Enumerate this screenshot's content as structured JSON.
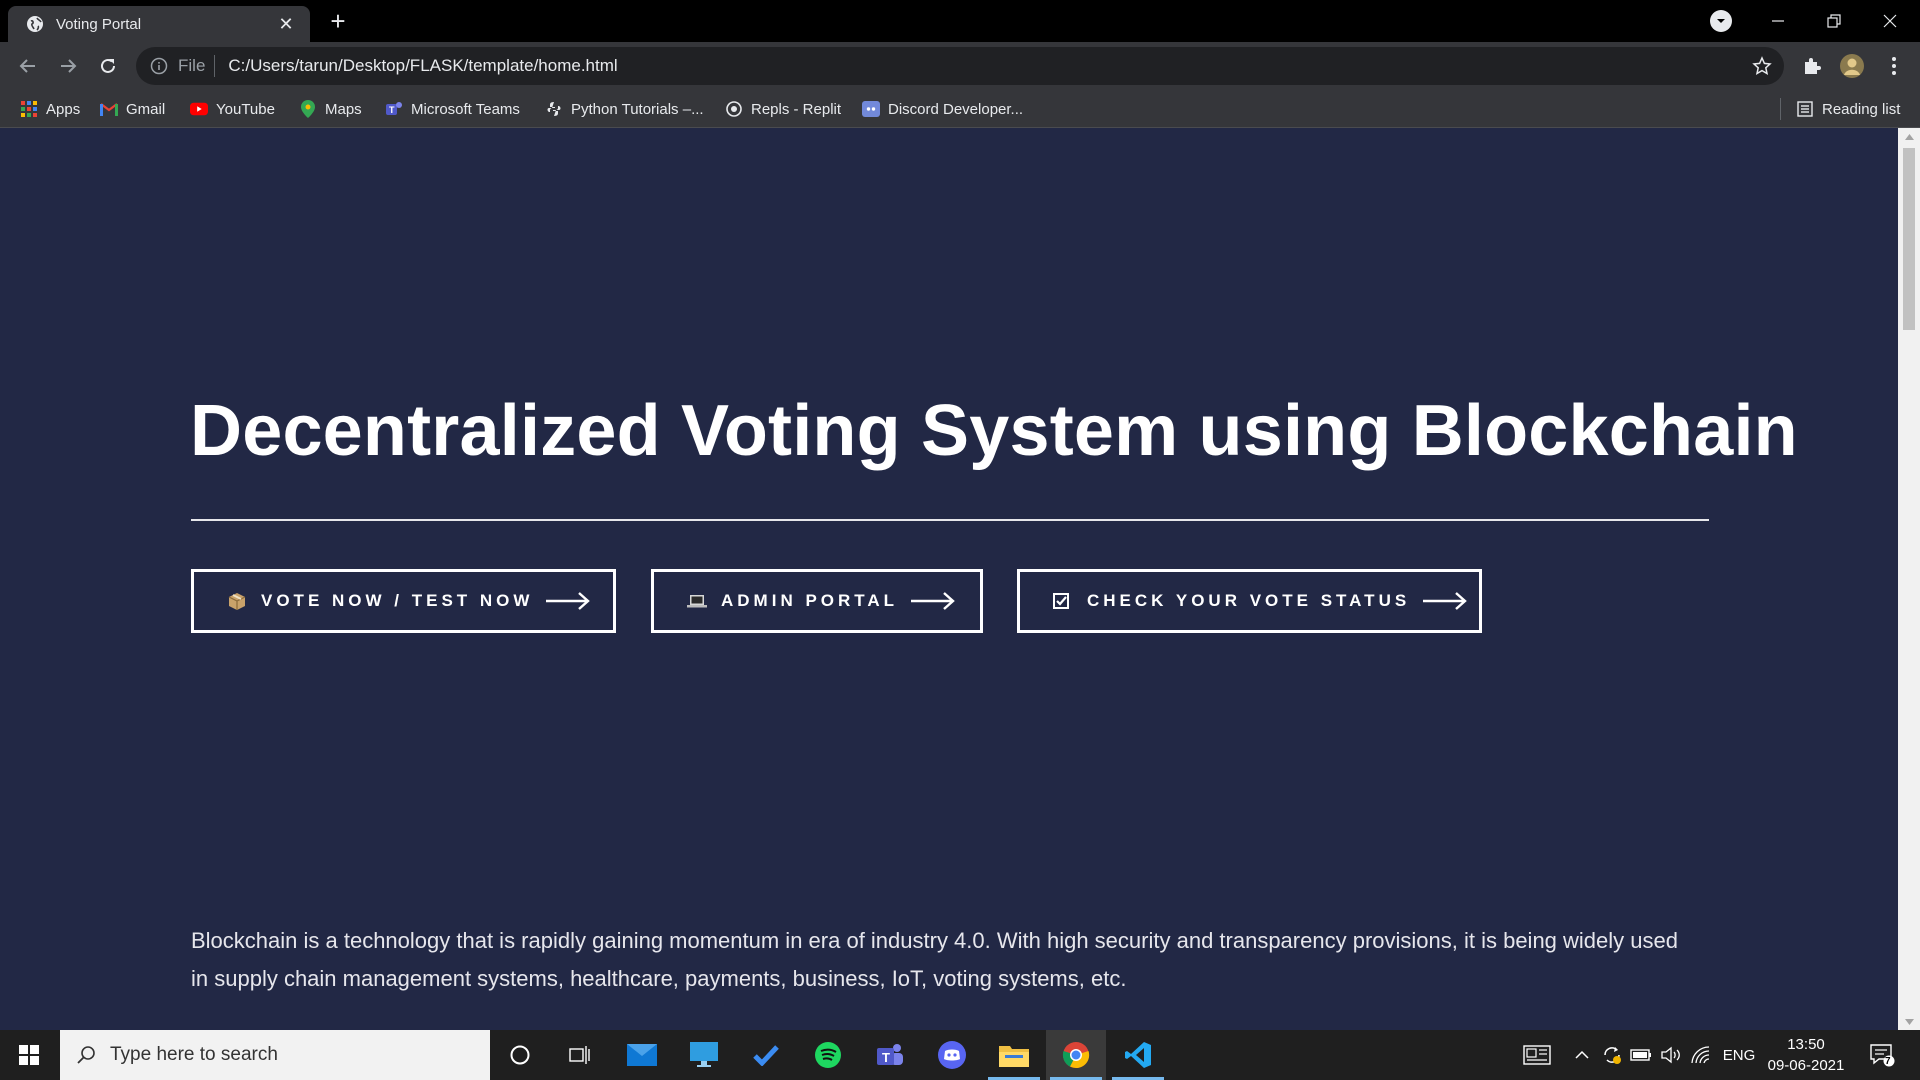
{
  "browser": {
    "tab_title": "Voting Portal",
    "address_scheme": "File",
    "address_url": "C:/Users/tarun/Desktop/FLASK/template/home.html",
    "bookmarks": [
      {
        "label": "Apps",
        "icon": "apps-grid-icon"
      },
      {
        "label": "Gmail",
        "icon": "gmail-icon"
      },
      {
        "label": "YouTube",
        "icon": "youtube-icon"
      },
      {
        "label": "Maps",
        "icon": "maps-pin-icon"
      },
      {
        "label": "Microsoft Teams",
        "icon": "teams-icon"
      },
      {
        "label": "Python Tutorials –...",
        "icon": "python-icon"
      },
      {
        "label": "Repls - Replit",
        "icon": "replit-icon"
      },
      {
        "label": "Discord Developer...",
        "icon": "discord-icon"
      }
    ],
    "reading_list": "Reading list"
  },
  "page": {
    "headline": "Decentralized Voting System using Blockchain",
    "buttons": [
      {
        "label": "VOTE NOW / TEST NOW",
        "icon": "package-icon"
      },
      {
        "label": "ADMIN PORTAL",
        "icon": "laptop-icon"
      },
      {
        "label": "CHECK YOUR VOTE STATUS",
        "icon": "checkbox-icon"
      }
    ],
    "intro": "Blockchain is a technology that is rapidly gaining momentum in era of industry 4.0. With high security and transparency provisions, it is being widely used in supply chain management systems, healthcare, payments, business, IoT, voting systems, etc."
  },
  "taskbar": {
    "search_placeholder": "Type here to search",
    "language": "ENG",
    "time": "13:50",
    "date": "09-06-2021",
    "notification_count": "7"
  },
  "colors": {
    "page_background": "#222845",
    "accent_text": "#ffffff",
    "taskbar_active_underline": "#76b9ed"
  }
}
